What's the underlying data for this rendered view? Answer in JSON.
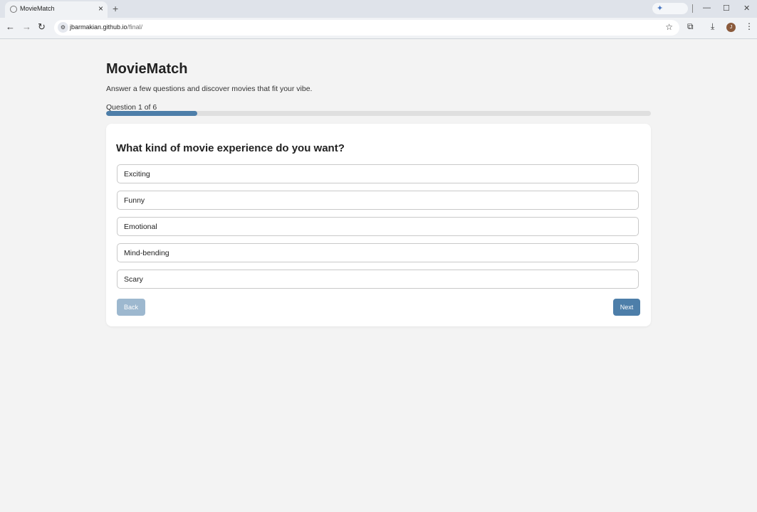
{
  "browser": {
    "tab_title": "MovieMatch",
    "tab_close": "×",
    "new_tab": "+",
    "url_host": "jbarmakian.github.io",
    "url_path": "/final/",
    "back_icon": "←",
    "forward_icon": "→",
    "reload_icon": "↻",
    "star_icon": "☆",
    "extensions_icon": "⧉",
    "download_icon": "⤓",
    "menu_icon": "⋮",
    "avatar_letter": "J",
    "gemini_icon": "✦",
    "minimize": "—",
    "maximize": "☐",
    "close": "✕",
    "site_icon": "⚙"
  },
  "app": {
    "title": "MovieMatch",
    "subtitle": "Answer a few questions and discover movies that fit your vibe.",
    "question_counter": "Question 1 of 6",
    "progress_fraction": 0.167,
    "question": "What kind of movie experience do you want?",
    "options": [
      "Exciting",
      "Funny",
      "Emotional",
      "Mind-bending",
      "Scary"
    ],
    "back_label": "Back",
    "next_label": "Next"
  },
  "colors": {
    "accent": "#4d7ea9",
    "accent_disabled": "#9db8cf",
    "background": "#f3f3f3"
  }
}
